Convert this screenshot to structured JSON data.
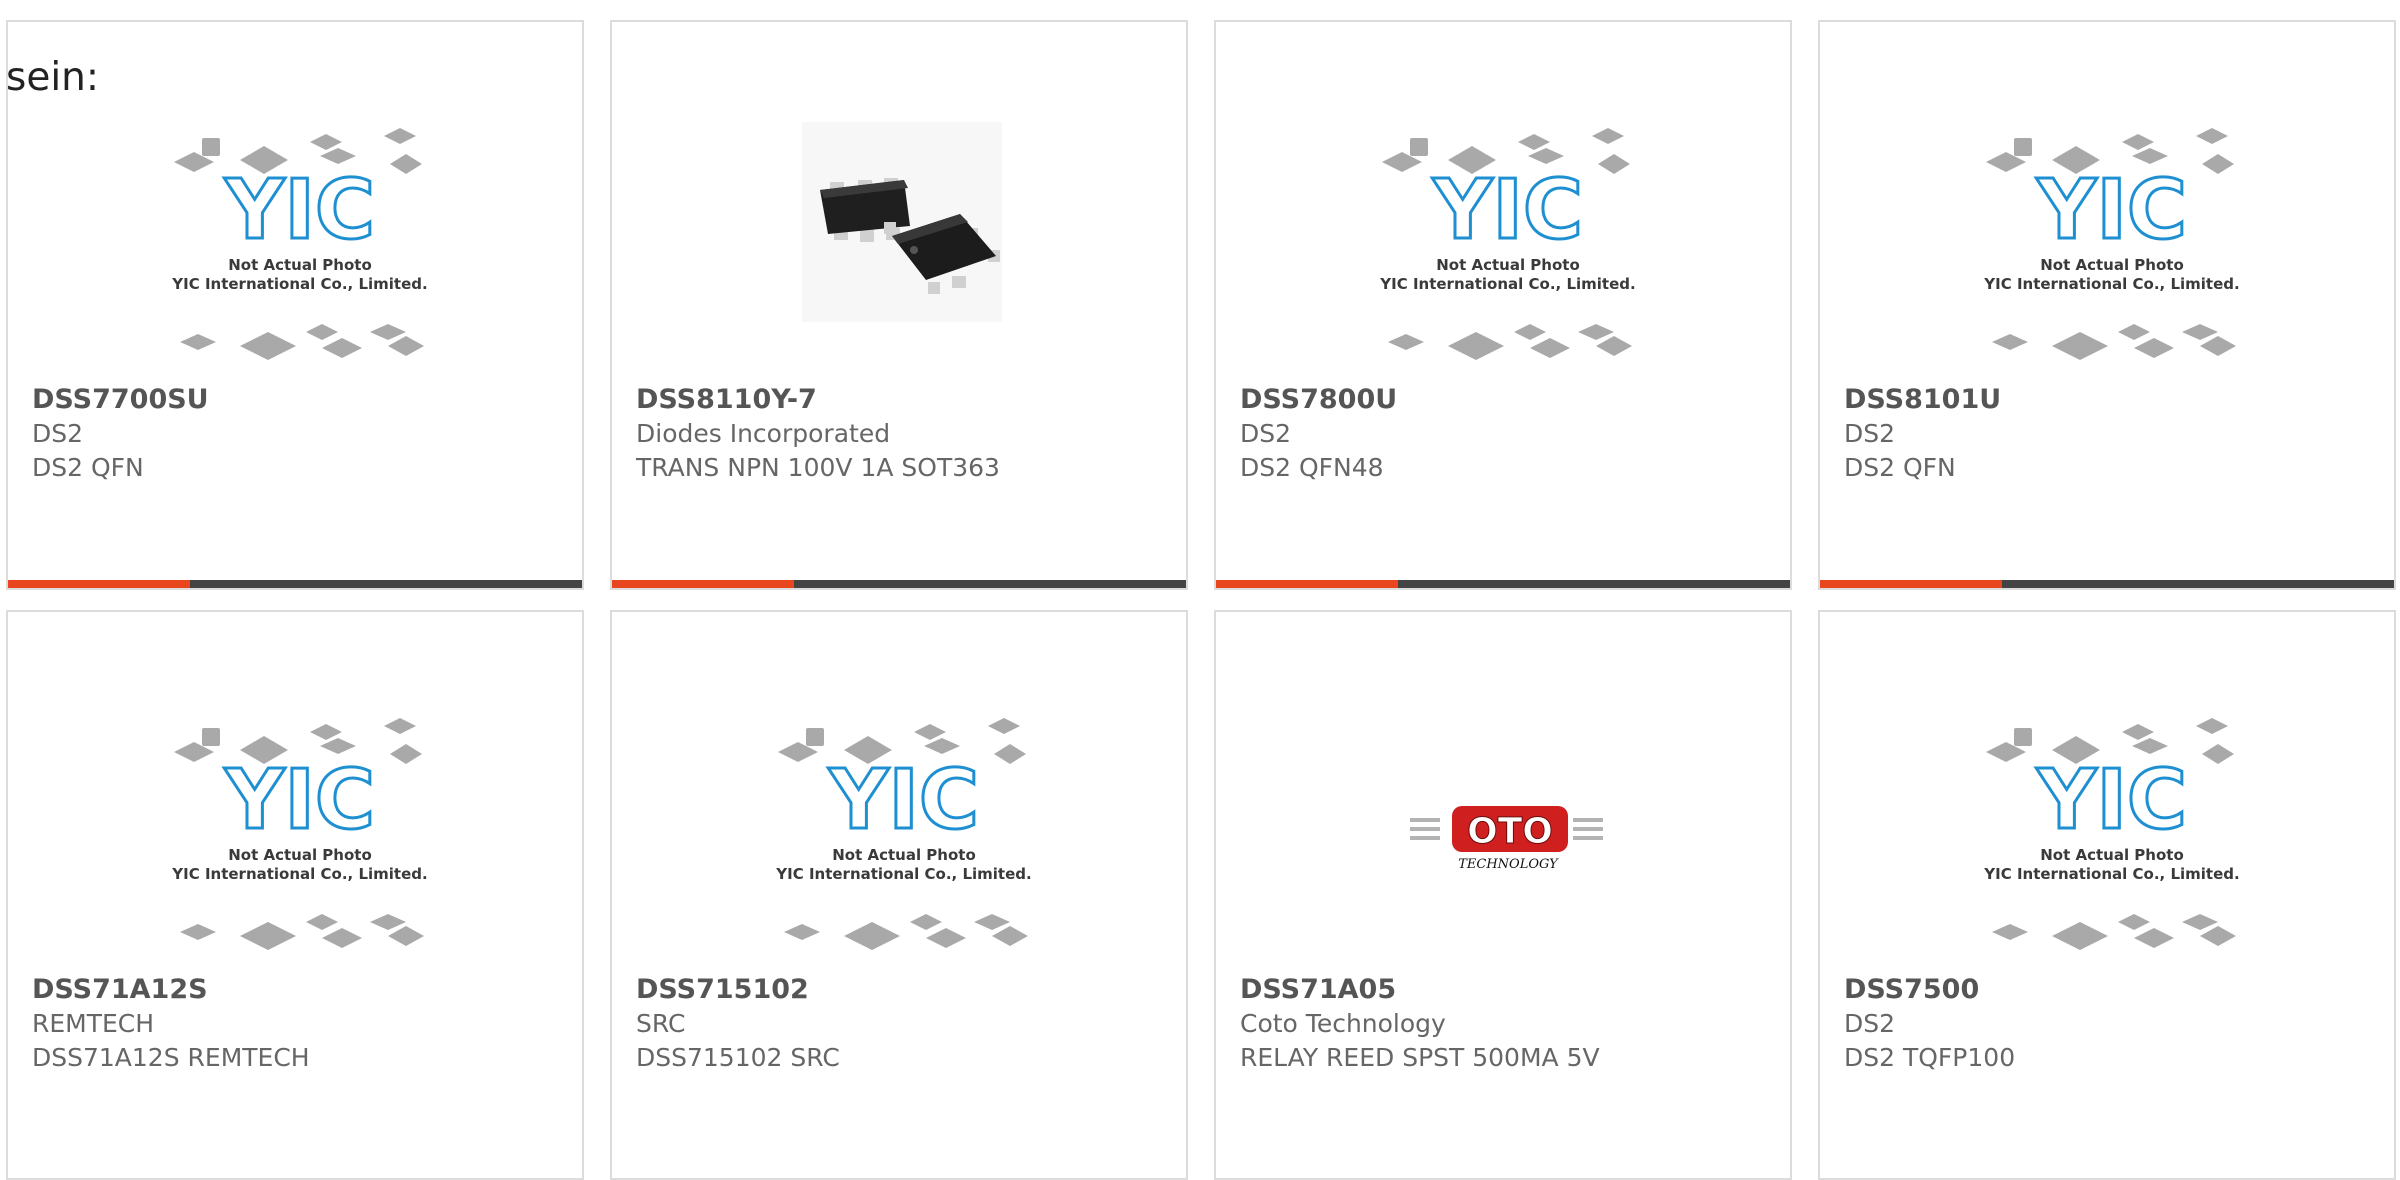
{
  "intro_text": "sein:",
  "colors": {
    "accent": "#e8461e",
    "bar": "#444444",
    "border": "#dcdcdc",
    "yic_blue": "#1e8fd1",
    "coto_red": "#cf1f1f"
  },
  "placeholder": {
    "icon": "not-actual-photo-icon",
    "brand": "YIC",
    "line1": "Not Actual Photo",
    "line2": "YIC International Co., Limited."
  },
  "products": [
    {
      "part_number": "DSS7700SU",
      "manufacturer": "DS2",
      "description": "DS2 QFN",
      "image": "placeholder"
    },
    {
      "part_number": "DSS8110Y-7",
      "manufacturer": "Diodes Incorporated",
      "description": "TRANS NPN 100V 1A SOT363",
      "image": "chip-photo"
    },
    {
      "part_number": "DSS7800U",
      "manufacturer": "DS2",
      "description": "DS2 QFN48",
      "image": "placeholder"
    },
    {
      "part_number": "DSS8101U",
      "manufacturer": "DS2",
      "description": "DS2 QFN",
      "image": "placeholder"
    },
    {
      "part_number": "DSS71A12S",
      "manufacturer": "REMTECH",
      "description": "DSS71A12S REMTECH",
      "image": "placeholder"
    },
    {
      "part_number": "DSS715102",
      "manufacturer": "SRC",
      "description": "DSS715102 SRC",
      "image": "placeholder"
    },
    {
      "part_number": "DSS71A05",
      "manufacturer": "Coto Technology",
      "description": "RELAY REED SPST 500MA 5V",
      "image": "coto-logo"
    },
    {
      "part_number": "DSS7500",
      "manufacturer": "DS2",
      "description": "DS2 TQFP100",
      "image": "placeholder"
    }
  ]
}
